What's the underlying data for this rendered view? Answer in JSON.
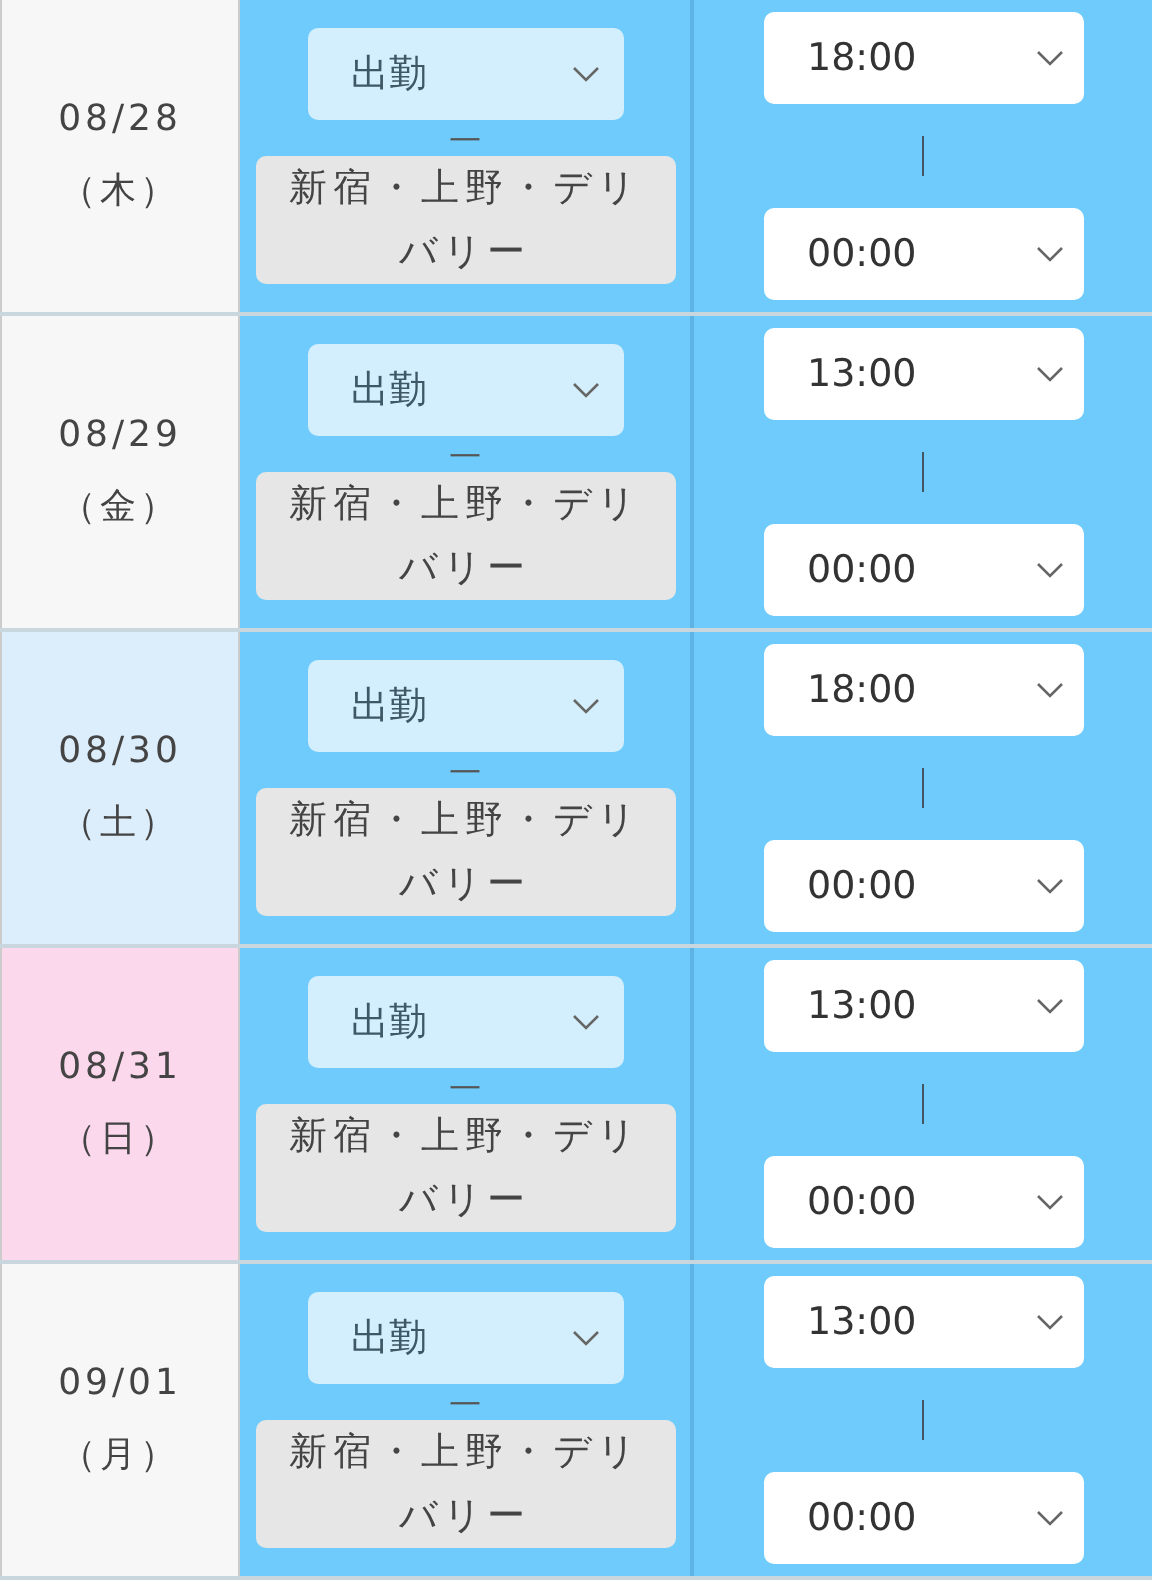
{
  "rows": [
    {
      "date": "08/28",
      "weekday": "（木）",
      "color": "#f7f7f7",
      "status": "出勤",
      "separator": "—",
      "area": "新宿・上野・デリバリー",
      "start_time": "18:00",
      "end_time": "00:00"
    },
    {
      "date": "08/29",
      "weekday": "（金）",
      "color": "#f7f7f7",
      "status": "出勤",
      "separator": "—",
      "area": "新宿・上野・デリバリー",
      "start_time": "13:00",
      "end_time": "00:00"
    },
    {
      "date": "08/30",
      "weekday": "（土）",
      "color": "#dcedfb",
      "status": "出勤",
      "separator": "—",
      "area": "新宿・上野・デリバリー",
      "start_time": "18:00",
      "end_time": "00:00"
    },
    {
      "date": "08/31",
      "weekday": "（日）",
      "color": "#fbd8ec",
      "status": "出勤",
      "separator": "—",
      "area": "新宿・上野・デリバリー",
      "start_time": "13:00",
      "end_time": "00:00"
    },
    {
      "date": "09/01",
      "weekday": "（月）",
      "color": "#f7f7f7",
      "status": "出勤",
      "separator": "—",
      "area": "新宿・上野・デリバリー",
      "start_time": "13:00",
      "end_time": "00:00"
    }
  ]
}
